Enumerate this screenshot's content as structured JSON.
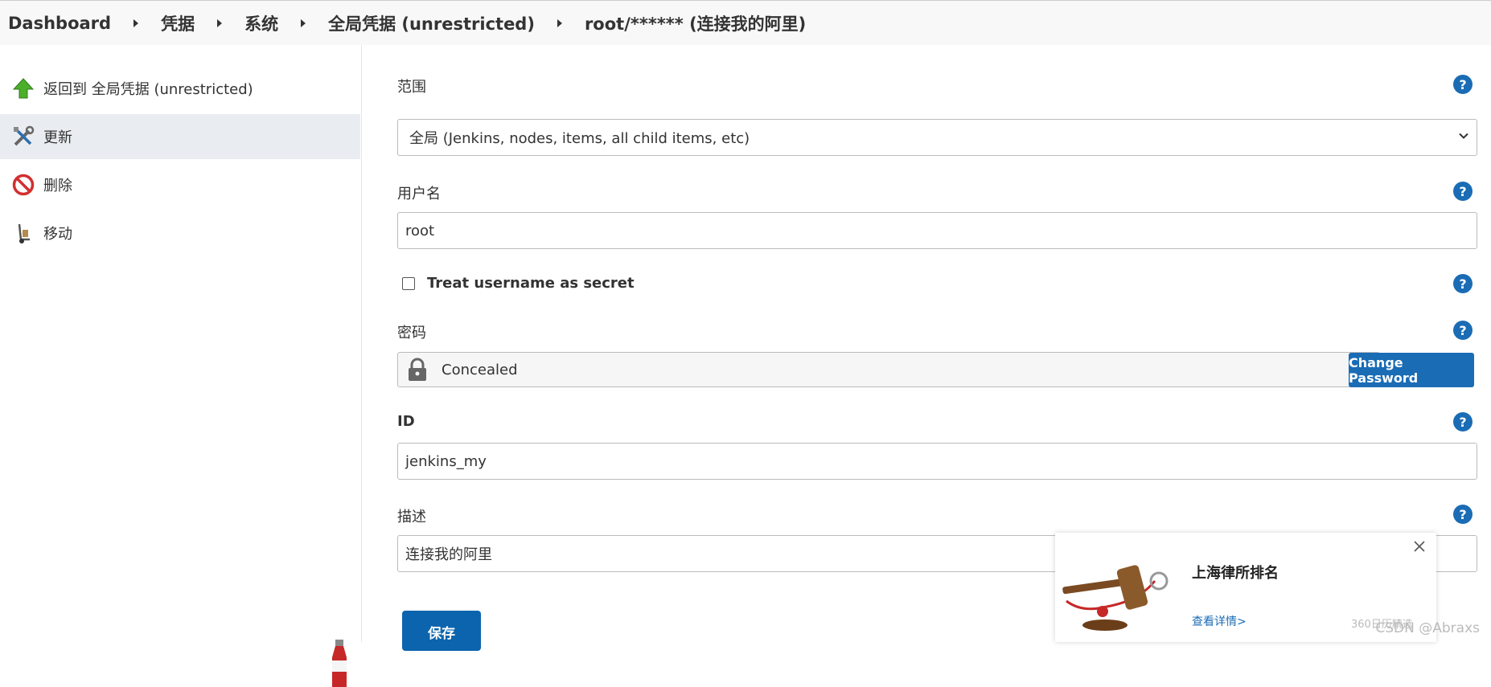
{
  "breadcrumb": {
    "items": [
      "Dashboard",
      "凭据",
      "系统",
      "全局凭据 (unrestricted)",
      "root/****** (连接我的阿里)"
    ]
  },
  "sidebar": {
    "items": [
      {
        "label": "返回到 全局凭据 (unrestricted)",
        "icon": "up-arrow-icon"
      },
      {
        "label": "更新",
        "icon": "tools-icon",
        "active": true
      },
      {
        "label": "删除",
        "icon": "no-entry-icon"
      },
      {
        "label": "移动",
        "icon": "hand-truck-icon"
      }
    ]
  },
  "form": {
    "scope": {
      "label": "范围",
      "value": "全局 (Jenkins, nodes, items, all child items, etc)"
    },
    "username": {
      "label": "用户名",
      "value": "root"
    },
    "treat_secret": {
      "label": "Treat username as secret",
      "checked": false
    },
    "password": {
      "label": "密码",
      "value": "Concealed",
      "change_button": "Change Password"
    },
    "id": {
      "label": "ID",
      "value": "jenkins_my"
    },
    "description": {
      "label": "描述",
      "value": "连接我的阿里"
    },
    "save_button": "保存",
    "help_symbol": "?"
  },
  "ad": {
    "title": "上海律所排名",
    "link": "查看详情>",
    "source": "360日历精选"
  },
  "watermark": "CSDN @Abraxs",
  "colors": {
    "accent": "#1a6cb4",
    "active_sidebar": "#e9edf1",
    "breadcrumb_bg": "#f8f8f8"
  }
}
